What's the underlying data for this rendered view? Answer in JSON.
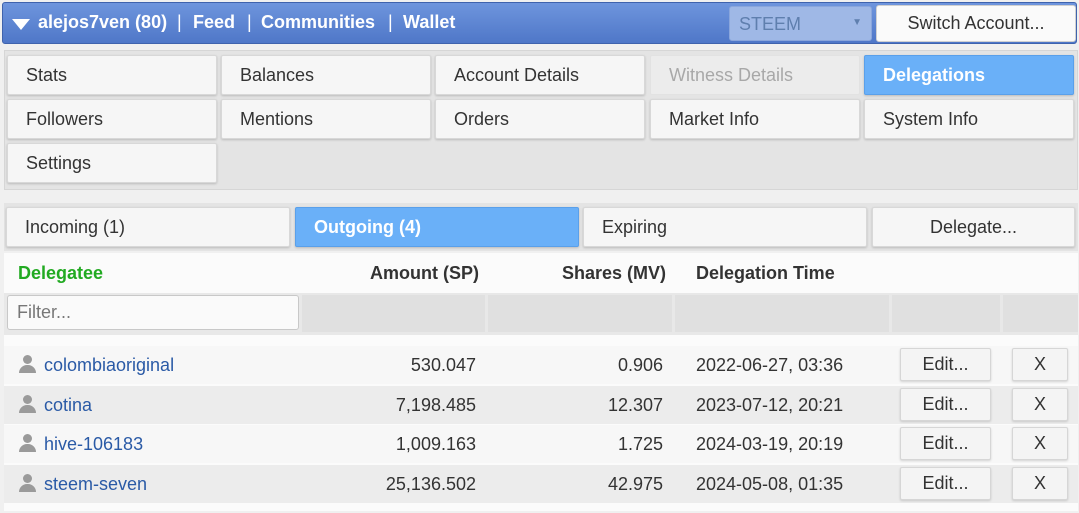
{
  "topbar": {
    "account": "alejos7ven (80)",
    "nav": [
      "Feed",
      "Communities",
      "Wallet"
    ],
    "separator": "|",
    "chain_select": "STEEM",
    "switch_account": "Switch Account..."
  },
  "tabs": [
    {
      "label": "Stats"
    },
    {
      "label": "Balances"
    },
    {
      "label": "Account Details"
    },
    {
      "label": "Witness Details"
    },
    {
      "label": "Delegations"
    },
    {
      "label": "Followers"
    },
    {
      "label": "Mentions"
    },
    {
      "label": "Orders"
    },
    {
      "label": "Market Info"
    },
    {
      "label": "System Info"
    },
    {
      "label": "Settings"
    }
  ],
  "subtabs": {
    "incoming": "Incoming (1)",
    "outgoing": "Outgoing (4)",
    "expiring": "Expiring",
    "delegate": "Delegate..."
  },
  "table": {
    "headers": {
      "delegatee": "Delegatee",
      "amount": "Amount (SP)",
      "shares": "Shares (MV)",
      "time": "Delegation Time"
    },
    "filter_placeholder": "Filter...",
    "edit_label": "Edit...",
    "remove_label": "X",
    "rows": [
      {
        "delegatee": "colombiaoriginal",
        "amount": "530.047",
        "shares": "0.906",
        "time": "2022-06-27, 03:36"
      },
      {
        "delegatee": "cotina",
        "amount": "7,198.485",
        "shares": "12.307",
        "time": "2023-07-12, 20:21"
      },
      {
        "delegatee": "hive-106183",
        "amount": "1,009.163",
        "shares": "1.725",
        "time": "2024-03-19, 20:19"
      },
      {
        "delegatee": "steem-seven",
        "amount": "25,136.502",
        "shares": "42.975",
        "time": "2024-05-08, 01:35"
      }
    ]
  },
  "colors": {
    "topbar": "#5a82d1",
    "active_tab": "#6ab0f8",
    "delegatee_header": "#22aa22",
    "link": "#2a5aa6"
  }
}
